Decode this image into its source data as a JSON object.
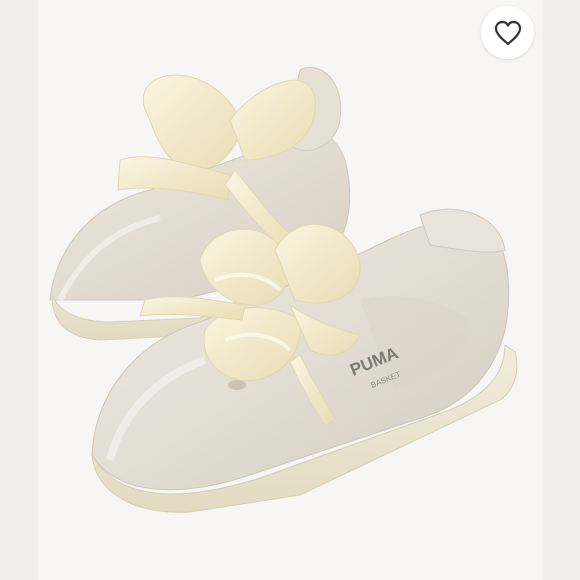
{
  "photo": {
    "subject": "sneaker-pair-with-satin-ribbon-laces"
  },
  "shoe_brand": {
    "logo_text": "PUMA",
    "sub_text": "BASKET"
  },
  "like": {
    "icon": "heart-outline-icon"
  },
  "colors": {
    "background": "#efeeec",
    "shoe_leather": "#e6dfd6",
    "sole": "#ece6d2",
    "ribbon": "#f3ecd3",
    "heart_stroke": "#333333"
  }
}
